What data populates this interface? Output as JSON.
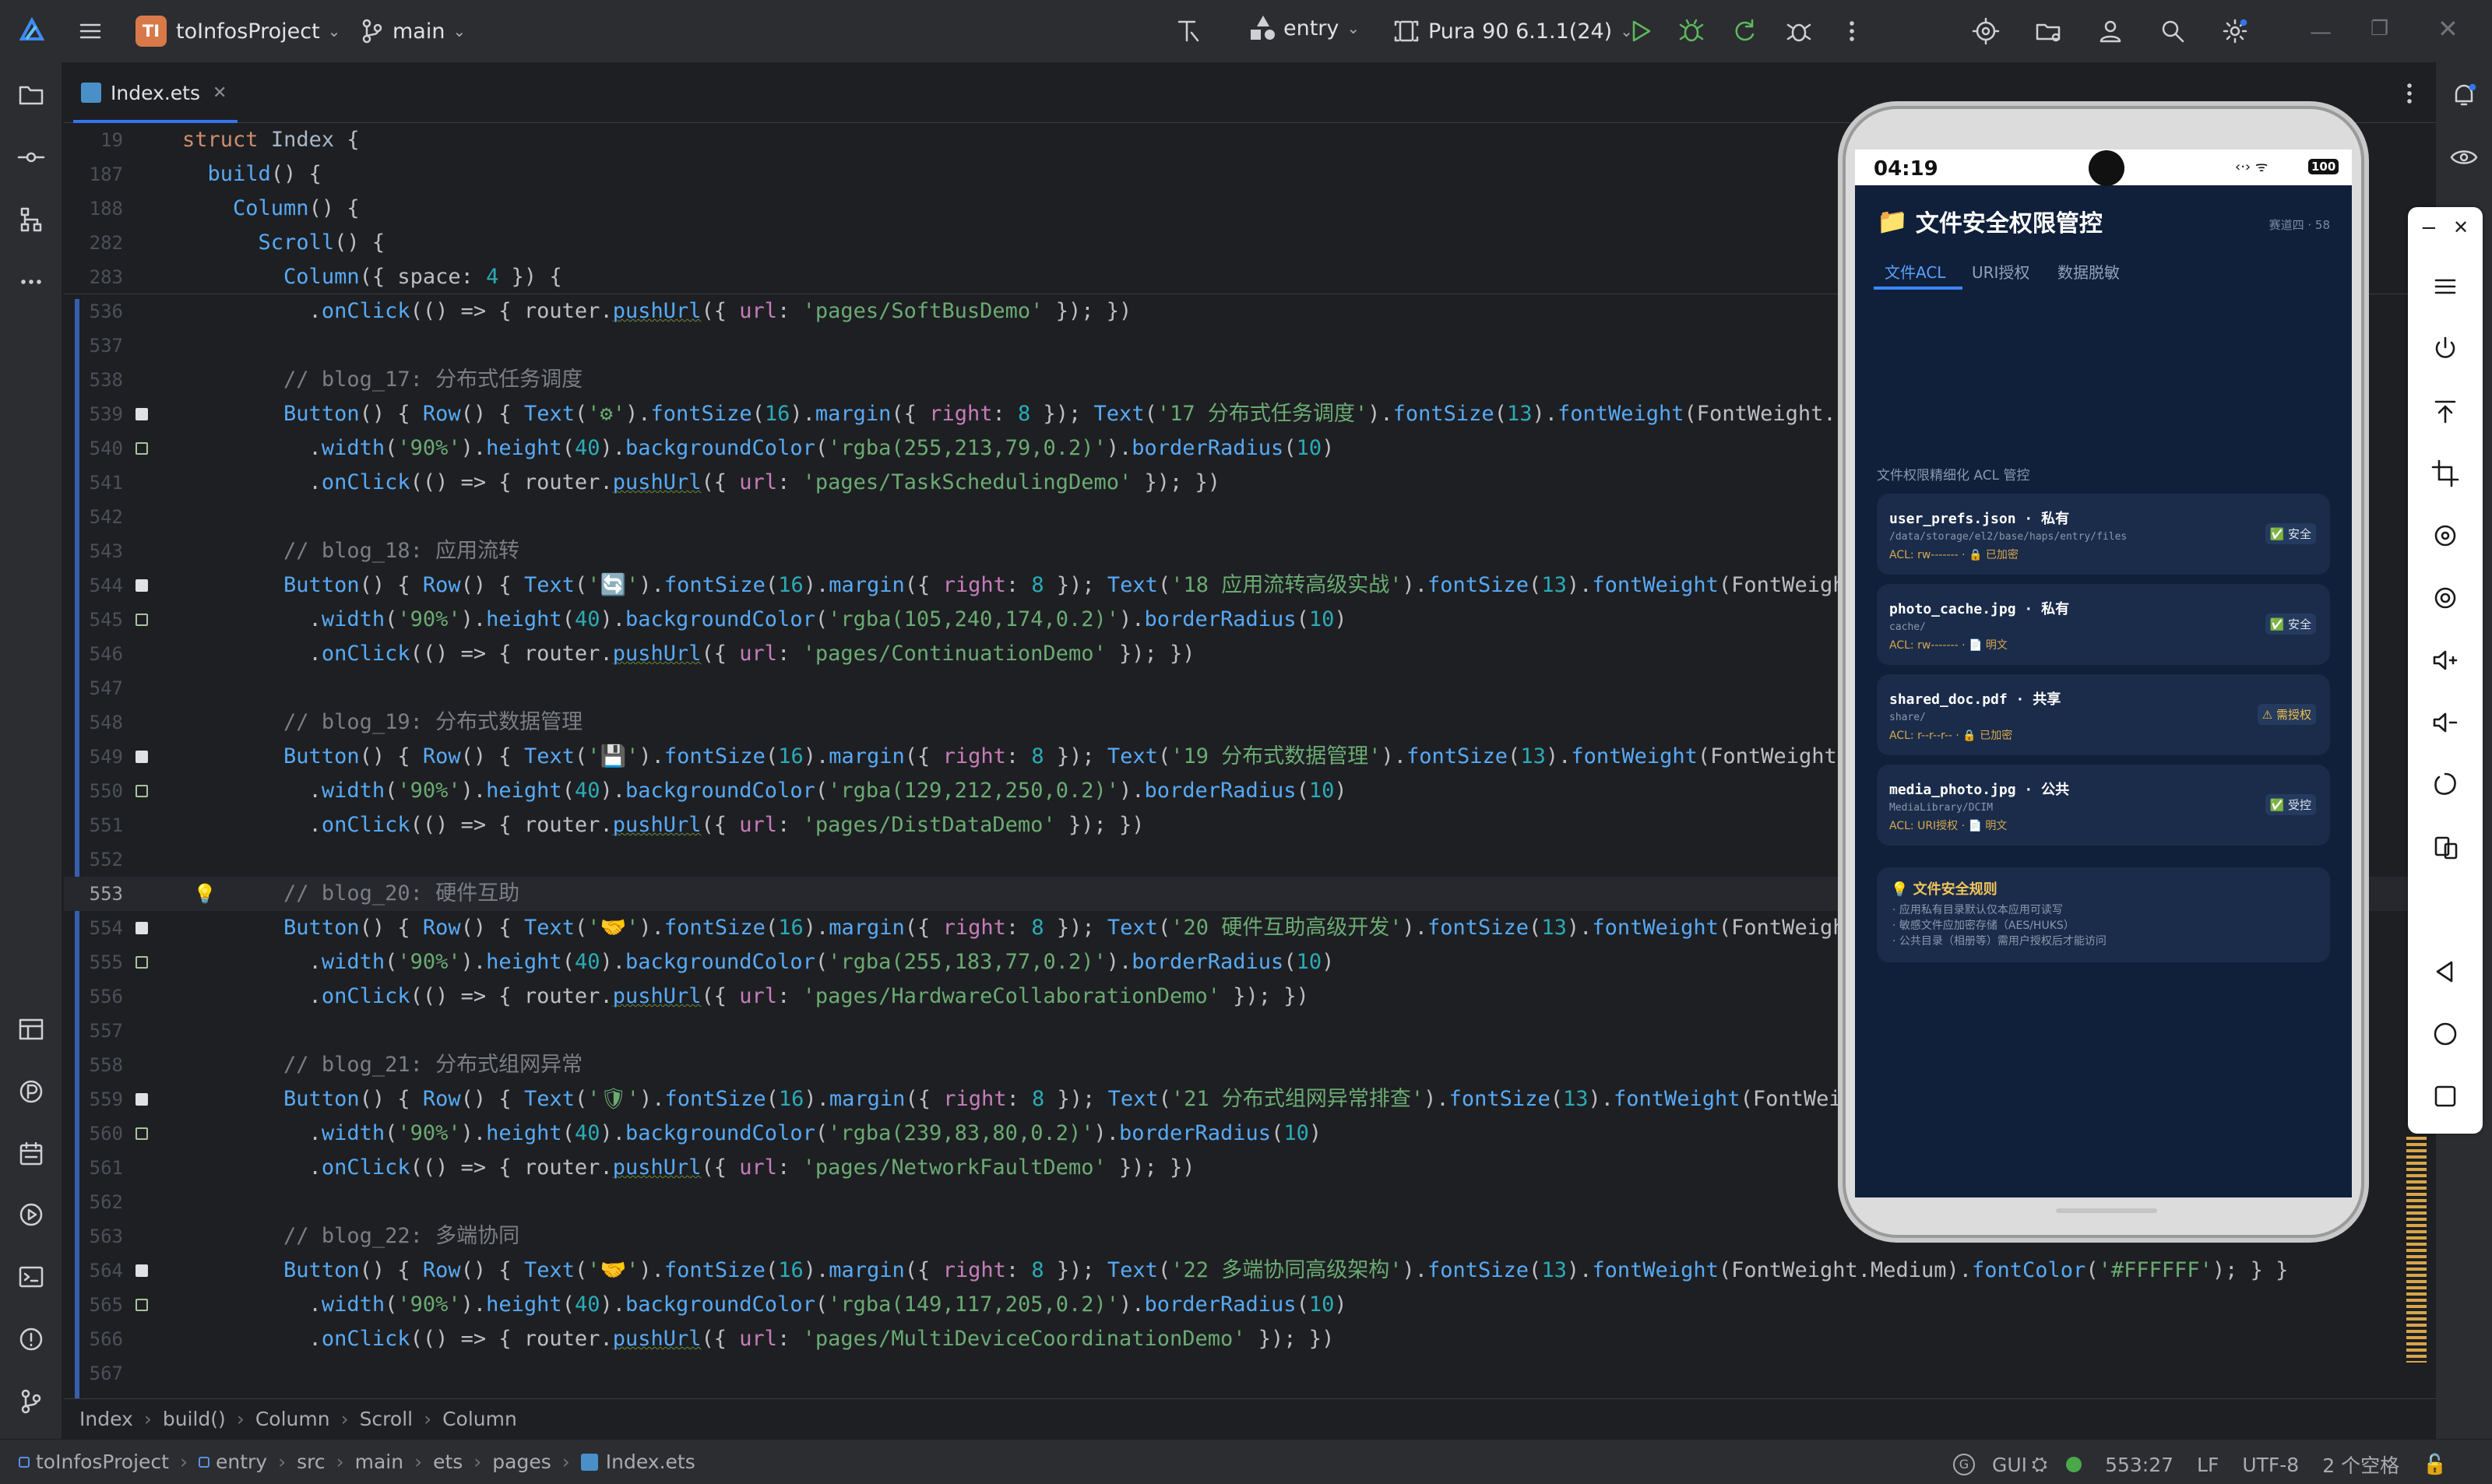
{
  "titlebar": {
    "project_badge": "TI",
    "project_name": "toInfosProject",
    "branch": "main",
    "run_config": "entry",
    "device": "Pura 90 6.1.1(24)"
  },
  "editor": {
    "tab_label": "Index.ets",
    "sticky_lines": [
      {
        "num": "19",
        "text": "struct Index {"
      },
      {
        "num": "187",
        "text": "  build() {"
      },
      {
        "num": "188",
        "text": "    Column() {"
      },
      {
        "num": "282",
        "text": "      Scroll() {"
      },
      {
        "num": "283",
        "text": "        Column({ space: 4 }) {"
      }
    ],
    "lines": [
      {
        "num": "536",
        "text": "          .onClick(() => { router.pushUrl({ url: 'pages/SoftBusDemo' }); })"
      },
      {
        "num": "537",
        "text": ""
      },
      {
        "num": "538",
        "text": "        // blog_17: 分布式任务调度"
      },
      {
        "num": "539",
        "text": "        Button() { Row() { Text('⚙').fontSize(16).margin({ right: 8 }); Text('17 分布式任务调度').fontSize(13).fontWeight(FontWeight."
      },
      {
        "num": "540",
        "text": "          .width('90%').height(40).backgroundColor('rgba(255,213,79,0.2)').borderRadius(10)"
      },
      {
        "num": "541",
        "text": "          .onClick(() => { router.pushUrl({ url: 'pages/TaskSchedulingDemo' }); })"
      },
      {
        "num": "542",
        "text": ""
      },
      {
        "num": "543",
        "text": "        // blog_18: 应用流转"
      },
      {
        "num": "544",
        "text": "        Button() { Row() { Text('🔄').fontSize(16).margin({ right: 8 }); Text('18 应用流转高级实战').fontSize(13).fontWeight(FontWeigh"
      },
      {
        "num": "545",
        "text": "          .width('90%').height(40).backgroundColor('rgba(105,240,174,0.2)').borderRadius(10)"
      },
      {
        "num": "546",
        "text": "          .onClick(() => { router.pushUrl({ url: 'pages/ContinuationDemo' }); })"
      },
      {
        "num": "547",
        "text": ""
      },
      {
        "num": "548",
        "text": "        // blog_19: 分布式数据管理"
      },
      {
        "num": "549",
        "text": "        Button() { Row() { Text('💾').fontSize(16).margin({ right: 8 }); Text('19 分布式数据管理').fontSize(13).fontWeight(FontWeight."
      },
      {
        "num": "550",
        "text": "          .width('90%').height(40).backgroundColor('rgba(129,212,250,0.2)').borderRadius(10)"
      },
      {
        "num": "551",
        "text": "          .onClick(() => { router.pushUrl({ url: 'pages/DistDataDemo' }); })"
      },
      {
        "num": "552",
        "text": ""
      },
      {
        "num": "553",
        "text": "        // blog_20: 硬件互助"
      },
      {
        "num": "554",
        "text": "        Button() { Row() { Text('🤝').fontSize(16).margin({ right: 8 }); Text('20 硬件互助高级开发').fontSize(13).fontWeight(FontWeigh"
      },
      {
        "num": "555",
        "text": "          .width('90%').height(40).backgroundColor('rgba(255,183,77,0.2)').borderRadius(10)"
      },
      {
        "num": "556",
        "text": "          .onClick(() => { router.pushUrl({ url: 'pages/HardwareCollaborationDemo' }); })"
      },
      {
        "num": "557",
        "text": ""
      },
      {
        "num": "558",
        "text": "        // blog_21: 分布式组网异常"
      },
      {
        "num": "559",
        "text": "        Button() { Row() { Text('🛡').fontSize(16).margin({ right: 8 }); Text('21 分布式组网异常排查').fontSize(13).fontWeight(FontWeig"
      },
      {
        "num": "560",
        "text": "          .width('90%').height(40).backgroundColor('rgba(239,83,80,0.2)').borderRadius(10)"
      },
      {
        "num": "561",
        "text": "          .onClick(() => { router.pushUrl({ url: 'pages/NetworkFaultDemo' }); })"
      },
      {
        "num": "562",
        "text": ""
      },
      {
        "num": "563",
        "text": "        // blog_22: 多端协同"
      },
      {
        "num": "564",
        "text": "        Button() { Row() { Text('🤝').fontSize(16).margin({ right: 8 }); Text('22 多端协同高级架构').fontSize(13).fontWeight(FontWeight.Medium).fontColor('#FFFFFF'); } }"
      },
      {
        "num": "565",
        "text": "          .width('90%').height(40).backgroundColor('rgba(149,117,205,0.2)').borderRadius(10)"
      },
      {
        "num": "566",
        "text": "          .onClick(() => { router.pushUrl({ url: 'pages/MultiDeviceCoordinationDemo' }); })"
      },
      {
        "num": "567",
        "text": ""
      }
    ]
  },
  "breadcrumb": [
    "Index",
    "build()",
    "Column",
    "Scroll",
    "Column"
  ],
  "statusbar": {
    "path": [
      "toInfosProject",
      "entry",
      "src",
      "main",
      "ets",
      "pages",
      "Index.ets"
    ],
    "gui": "GUI",
    "position": "553:27",
    "line_sep": "LF",
    "encoding": "UTF-8",
    "indent": "2 个空格"
  },
  "device_screen": {
    "time": "04:19",
    "battery": "100",
    "title": "文件安全权限管控",
    "subtitle": "赛道四 · 58",
    "tabs": [
      "文件ACL",
      "URI授权",
      "数据脱敏"
    ],
    "section_label": "文件权限精细化 ACL 管控",
    "files": [
      {
        "name": "user_prefs.json · 私有",
        "path": "/data/storage/el2/base/haps/entry/files",
        "meta": "ACL: rw------- · 🔒 已加密",
        "badge": "✅ 安全"
      },
      {
        "name": "photo_cache.jpg · 私有",
        "path": "cache/",
        "meta": "ACL: rw------- · 📄 明文",
        "badge": "✅ 安全"
      },
      {
        "name": "shared_doc.pdf · 共享",
        "path": "share/",
        "meta": "ACL: r--r--r-- · 🔒 已加密",
        "badge": "⚠ 需授权"
      },
      {
        "name": "media_photo.jpg · 公共",
        "path": "MediaLibrary/DCIM",
        "meta": "ACL: URI授权 · 📄 明文",
        "badge": "✅ 受控"
      }
    ],
    "rules_title": "💡 文件安全规则",
    "rules": [
      "· 应用私有目录默认仅本应用可读写",
      "· 敏感文件应加密存储（AES/HUKS）",
      "· 公共目录（相册等）需用户授权后才能访问"
    ]
  },
  "colors": {
    "accent": "#3574f0",
    "keyword": "#cf8e6d",
    "string": "#6aab73",
    "function": "#57aaf7",
    "number": "#2aacb8",
    "comment": "#7a7e85",
    "run": "#5fb85f"
  }
}
